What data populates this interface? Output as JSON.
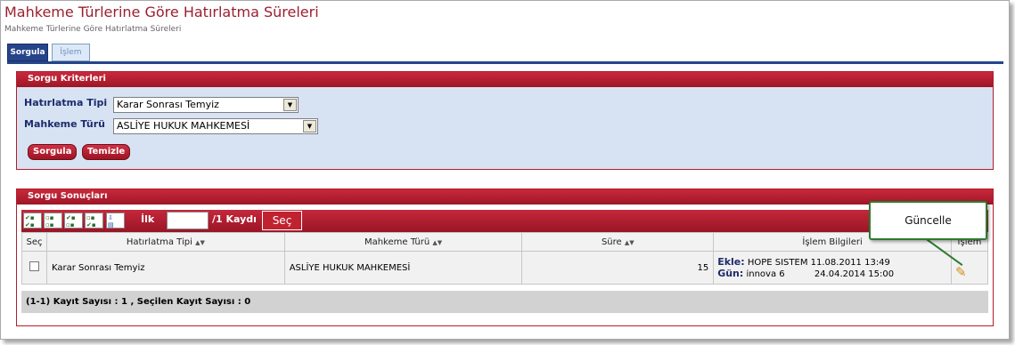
{
  "page": {
    "title": "Mahkeme Türlerine Göre Hatırlatma Süreleri",
    "subtitle": "Mahkeme Türlerine Göre Hatırlatma Süreleri"
  },
  "tabs": [
    {
      "label": "Sorgula",
      "active": true
    },
    {
      "label": "İşlem",
      "active": false
    }
  ],
  "criteria": {
    "title": "Sorgu Kriterleri",
    "hatirlatma_label": "Hatırlatma Tipi",
    "hatirlatma_value": "Karar Sonrası Temyiz",
    "mahkeme_label": "Mahkeme Türü",
    "mahkeme_value": "ASLİYE HUKUK MAHKEMESİ",
    "search_button": "Sorgula",
    "clear_button": "Temizle"
  },
  "results": {
    "title": "Sorgu Sonuçları",
    "pager_first": "İlk",
    "pager_total": "/1 Kaydı",
    "pager_button": "Seç",
    "columns": [
      "Seç",
      "Hatırlatma Tipi",
      "Mahkeme Türü",
      "Süre",
      "İşlem Bilgileri",
      "İşlem"
    ],
    "rows": [
      {
        "hatirlatma_tipi": "Karar Sonrası Temyiz",
        "mahkeme_turu": "ASLİYE HUKUK MAHKEMESİ",
        "sure": "15",
        "ekle_label": "Ekle:",
        "ekle_user": "HOPE SISTEM",
        "ekle_date": "11.08.2011 13:49",
        "gun_label": "Gün:",
        "gun_user": "innova 6",
        "gun_date": "24.04.2014 15:00"
      }
    ],
    "footer": "(1-1) Kayıt Sayısı : 1 , Seçilen Kayıt Sayısı : 0"
  },
  "callout": {
    "label": "Güncelle"
  },
  "colors": {
    "accent": "#b01e2c",
    "panel_bg": "#d7e3f3",
    "tab_active": "#26448a"
  }
}
